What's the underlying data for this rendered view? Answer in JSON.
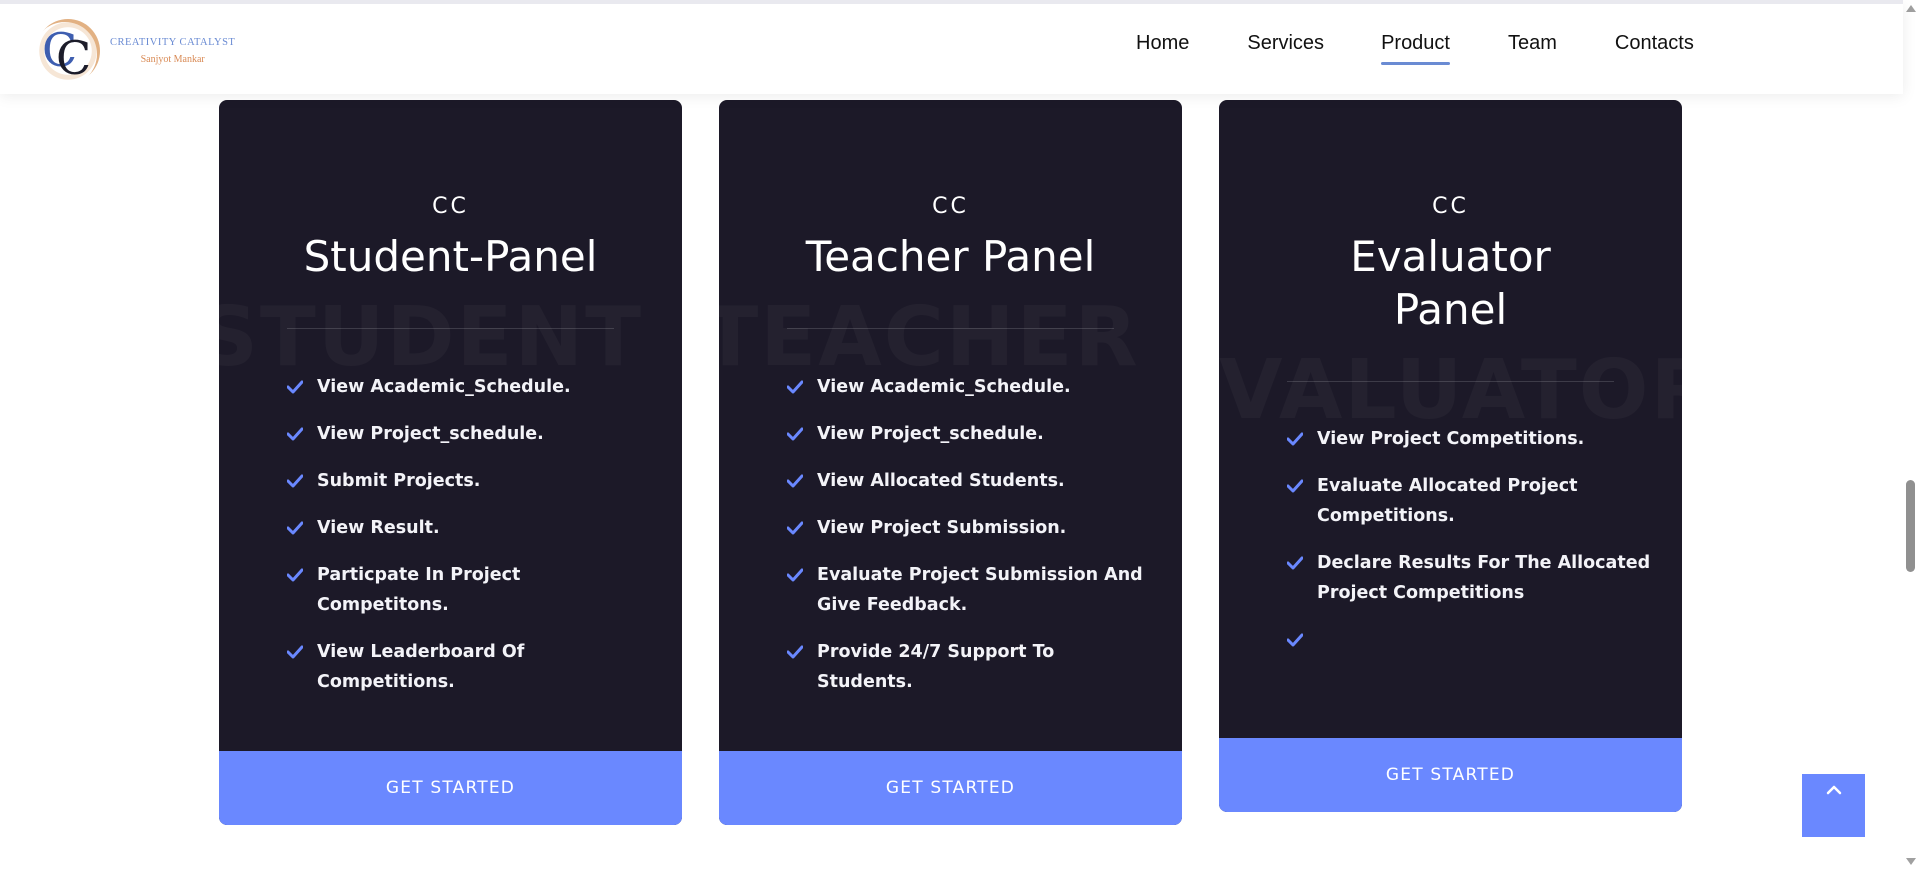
{
  "header": {
    "logo_title": "CREATIVITY CATALYST",
    "logo_subtitle": "Sanjyot Mankar",
    "nav": [
      {
        "label": "Home"
      },
      {
        "label": "Services"
      },
      {
        "label": "Product",
        "active": true
      },
      {
        "label": "Team"
      },
      {
        "label": "Contacts"
      }
    ]
  },
  "cards": [
    {
      "watermark": "STUDENT",
      "prefix": "CC",
      "title_line1": "Student-Panel",
      "title_line2": "",
      "features": [
        "View Academic_Schedule.",
        "View Project_schedule.",
        "Submit Projects.",
        "View Result.",
        "Particpate In Project Competitons.",
        "View Leaderboard Of Competitions."
      ],
      "cta": "GET STARTED"
    },
    {
      "watermark": "TEACHER",
      "prefix": "CC",
      "title_line1": "Teacher Panel",
      "title_line2": "",
      "features": [
        "View Academic_Schedule.",
        "View Project_schedule.",
        "View Allocated Students.",
        "View Project Submission.",
        "Evaluate Project Submission And Give Feedback.",
        "Provide 24/7 Support To Students."
      ],
      "cta": "GET STARTED"
    },
    {
      "watermark": "EVALUATOR",
      "prefix": "CC",
      "title_line1": "Evaluator",
      "title_line2": "Panel",
      "features": [
        "View Project Competitions.",
        "Evaluate Allocated Project Competitions.",
        "Declare Results For The Allocated Project Competitions",
        ""
      ],
      "cta": "GET STARTED"
    }
  ],
  "colors": {
    "card_bg": "#1c1928",
    "accent": "#6a88ff",
    "check": "#6a88ff"
  },
  "icons": {
    "check": "check-icon",
    "back_to_top": "chevron-up-icon"
  }
}
